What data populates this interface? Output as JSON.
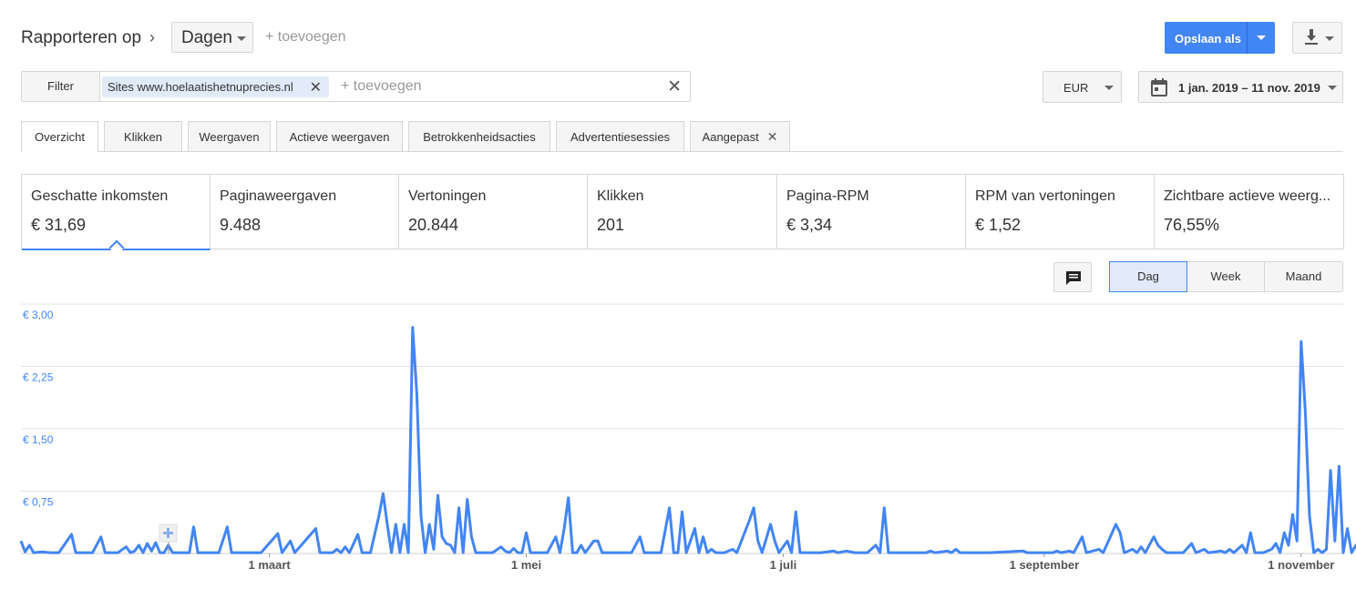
{
  "header": {
    "title": "Rapporteren op",
    "dimension": "Dagen",
    "add_dimension": "+ toevoegen",
    "save_label": "Opslaan als",
    "accent": "#4285f4"
  },
  "filter": {
    "button": "Filter",
    "chip_label": "Sites",
    "chip_value": "www.hoelaatishetnuprecies.nl",
    "add": "+ toevoegen"
  },
  "currency": "EUR",
  "date_range": "1 jan. 2019 – 11 nov. 2019",
  "tabs": [
    {
      "label": "Overzicht",
      "active": true
    },
    {
      "label": "Klikken"
    },
    {
      "label": "Weergaven"
    },
    {
      "label": "Actieve weergaven"
    },
    {
      "label": "Betrokkenheidsacties"
    },
    {
      "label": "Advertentiesessies"
    },
    {
      "label": "Aangepast",
      "closable": true
    }
  ],
  "metrics": [
    {
      "name": "Geschatte inkomsten",
      "value": "€ 31,69",
      "selected": true
    },
    {
      "name": "Paginaweergaven",
      "value": "9.488"
    },
    {
      "name": "Vertoningen",
      "value": "20.844"
    },
    {
      "name": "Klikken",
      "value": "201"
    },
    {
      "name": "Pagina-RPM",
      "value": "€ 3,34"
    },
    {
      "name": "RPM van vertoningen",
      "value": "€ 1,52"
    },
    {
      "name": "Zichtbare actieve weerg...",
      "value": "76,55%"
    }
  ],
  "granularity": {
    "options": [
      "Dag",
      "Week",
      "Maand"
    ],
    "selected": "Dag"
  },
  "icons": [
    "chevron-right-icon",
    "caret-down-icon",
    "download-icon",
    "close-icon",
    "calendar-icon",
    "comment-icon",
    "plus-icon"
  ],
  "chart_data": {
    "type": "line",
    "title": "",
    "ylabel": "",
    "xlabel": "",
    "ylim": [
      0,
      3
    ],
    "y_ticks": [
      "€ 3,00",
      "€ 2,25",
      "€ 1,50",
      "€ 0,75"
    ],
    "x_tick_labels": [
      "1 maart",
      "1 mei",
      "1 juli",
      "1 september",
      "1 november"
    ],
    "x_tick_days": [
      59,
      120,
      181,
      243,
      304
    ],
    "x_start": "2019-01-01",
    "x_end": "2019-11-11",
    "color": "#4285f4",
    "series": [
      {
        "name": "Geschatte inkomsten",
        "points": [
          [
            0,
            0.15
          ],
          [
            1,
            0.02
          ],
          [
            2,
            0.1
          ],
          [
            3,
            0.01
          ],
          [
            5,
            0.02
          ],
          [
            7,
            0.01
          ],
          [
            9,
            0.01
          ],
          [
            12,
            0.23
          ],
          [
            13,
            0.01
          ],
          [
            15,
            0.01
          ],
          [
            17,
            0.01
          ],
          [
            19,
            0.2
          ],
          [
            20,
            0.01
          ],
          [
            23,
            0.01
          ],
          [
            25,
            0.08
          ],
          [
            26,
            0.01
          ],
          [
            27,
            0.03
          ],
          [
            28,
            0.1
          ],
          [
            29,
            0.01
          ],
          [
            30,
            0.12
          ],
          [
            31,
            0.03
          ],
          [
            32,
            0.13
          ],
          [
            33,
            0.01
          ],
          [
            34,
            0.01
          ],
          [
            35,
            0.1
          ],
          [
            36,
            0.01
          ],
          [
            38,
            0.01
          ],
          [
            40,
            0.01
          ],
          [
            41,
            0.32
          ],
          [
            42,
            0.01
          ],
          [
            45,
            0.01
          ],
          [
            47,
            0.01
          ],
          [
            49,
            0.32
          ],
          [
            50,
            0.01
          ],
          [
            55,
            0.01
          ],
          [
            57,
            0.01
          ],
          [
            61,
            0.24
          ],
          [
            62,
            0.01
          ],
          [
            64,
            0.15
          ],
          [
            65,
            0.01
          ],
          [
            70,
            0.3
          ],
          [
            71,
            0.01
          ],
          [
            74,
            0.01
          ],
          [
            75,
            0.05
          ],
          [
            76,
            0.01
          ],
          [
            77,
            0.08
          ],
          [
            78,
            0.01
          ],
          [
            80,
            0.23
          ],
          [
            81,
            0.01
          ],
          [
            83,
            0.01
          ],
          [
            85,
            0.45
          ],
          [
            86,
            0.72
          ],
          [
            87,
            0.35
          ],
          [
            88,
            0.01
          ],
          [
            89,
            0.35
          ],
          [
            90,
            0.01
          ],
          [
            91,
            0.35
          ],
          [
            92,
            0.01
          ],
          [
            93,
            2.72
          ],
          [
            94,
            1.92
          ],
          [
            95,
            0.45
          ],
          [
            96,
            0.01
          ],
          [
            97,
            0.35
          ],
          [
            98,
            0.05
          ],
          [
            99,
            0.7
          ],
          [
            100,
            0.2
          ],
          [
            101,
            0.12
          ],
          [
            102,
            0.1
          ],
          [
            103,
            0.01
          ],
          [
            104,
            0.55
          ],
          [
            105,
            0.01
          ],
          [
            106,
            0.65
          ],
          [
            107,
            0.2
          ],
          [
            108,
            0.01
          ],
          [
            112,
            0.01
          ],
          [
            114,
            0.08
          ],
          [
            115,
            0.03
          ],
          [
            116,
            0.01
          ],
          [
            117,
            0.06
          ],
          [
            118,
            0.01
          ],
          [
            119,
            0.01
          ],
          [
            120,
            0.25
          ],
          [
            121,
            0.01
          ],
          [
            125,
            0.01
          ],
          [
            127,
            0.2
          ],
          [
            128,
            0.01
          ],
          [
            129,
            0.3
          ],
          [
            130,
            0.67
          ],
          [
            131,
            0.01
          ],
          [
            132,
            0.01
          ],
          [
            133,
            0.1
          ],
          [
            134,
            0.01
          ],
          [
            136,
            0.15
          ],
          [
            137,
            0.15
          ],
          [
            138,
            0.01
          ],
          [
            140,
            0.01
          ],
          [
            143,
            0.01
          ],
          [
            145,
            0.01
          ],
          [
            147,
            0.2
          ],
          [
            148,
            0.01
          ],
          [
            152,
            0.01
          ],
          [
            154,
            0.55
          ],
          [
            155,
            0.01
          ],
          [
            156,
            0.01
          ],
          [
            157,
            0.5
          ],
          [
            158,
            0.01
          ],
          [
            160,
            0.3
          ],
          [
            161,
            0.01
          ],
          [
            162,
            0.2
          ],
          [
            163,
            0.01
          ],
          [
            164,
            0.05
          ],
          [
            165,
            0.01
          ],
          [
            167,
            0.01
          ],
          [
            169,
            0.05
          ],
          [
            170,
            0.01
          ],
          [
            173,
            0.4
          ],
          [
            174,
            0.55
          ],
          [
            175,
            0.15
          ],
          [
            176,
            0.01
          ],
          [
            178,
            0.35
          ],
          [
            179,
            0.15
          ],
          [
            180,
            0.01
          ],
          [
            182,
            0.15
          ],
          [
            183,
            0.01
          ],
          [
            184,
            0.5
          ],
          [
            185,
            0.01
          ],
          [
            187,
            0.01
          ],
          [
            190,
            0.01
          ],
          [
            193,
            0.03
          ],
          [
            194,
            0.01
          ],
          [
            196,
            0.03
          ],
          [
            198,
            0.01
          ],
          [
            201,
            0.01
          ],
          [
            203,
            0.1
          ],
          [
            204,
            0.01
          ],
          [
            205,
            0.55
          ],
          [
            206,
            0.01
          ],
          [
            210,
            0.01
          ],
          [
            215,
            0.01
          ],
          [
            216,
            0.03
          ],
          [
            217,
            0.01
          ],
          [
            220,
            0.03
          ],
          [
            221,
            0.01
          ],
          [
            222,
            0.05
          ],
          [
            223,
            0.01
          ],
          [
            227,
            0.01
          ],
          [
            230,
            0.01
          ],
          [
            238,
            0.03
          ],
          [
            239,
            0.01
          ],
          [
            245,
            0.01
          ],
          [
            246,
            0.03
          ],
          [
            247,
            0.01
          ],
          [
            249,
            0.03
          ],
          [
            250,
            0.01
          ],
          [
            252,
            0.2
          ],
          [
            253,
            0.01
          ],
          [
            256,
            0.05
          ],
          [
            257,
            0.01
          ],
          [
            260,
            0.35
          ],
          [
            261,
            0.25
          ],
          [
            262,
            0.01
          ],
          [
            264,
            0.05
          ],
          [
            265,
            0.01
          ],
          [
            266,
            0.08
          ],
          [
            267,
            0.01
          ],
          [
            269,
            0.2
          ],
          [
            270,
            0.1
          ],
          [
            271,
            0.05
          ],
          [
            272,
            0.01
          ],
          [
            276,
            0.01
          ],
          [
            278,
            0.12
          ],
          [
            279,
            0.01
          ],
          [
            281,
            0.05
          ],
          [
            282,
            0.01
          ],
          [
            285,
            0.03
          ],
          [
            286,
            0.01
          ],
          [
            287,
            0.05
          ],
          [
            288,
            0.01
          ],
          [
            290,
            0.1
          ],
          [
            291,
            0.01
          ],
          [
            292,
            0.25
          ],
          [
            293,
            0.01
          ],
          [
            295,
            0.01
          ],
          [
            297,
            0.05
          ],
          [
            298,
            0.12
          ],
          [
            299,
            0.01
          ],
          [
            300,
            0.25
          ],
          [
            301,
            0.1
          ],
          [
            302,
            0.47
          ],
          [
            303,
            0.15
          ],
          [
            304,
            2.55
          ],
          [
            305,
            1.7
          ],
          [
            306,
            0.45
          ],
          [
            307,
            0.01
          ],
          [
            308,
            0.05
          ],
          [
            309,
            0.01
          ],
          [
            310,
            0.05
          ],
          [
            311,
            1.0
          ],
          [
            312,
            0.15
          ],
          [
            313,
            1.05
          ],
          [
            314,
            0.01
          ],
          [
            315,
            0.3
          ],
          [
            316,
            0.01
          ],
          [
            317,
            0.1
          ],
          [
            318,
            0.01
          ],
          [
            319,
            0.05
          ]
        ]
      }
    ]
  }
}
